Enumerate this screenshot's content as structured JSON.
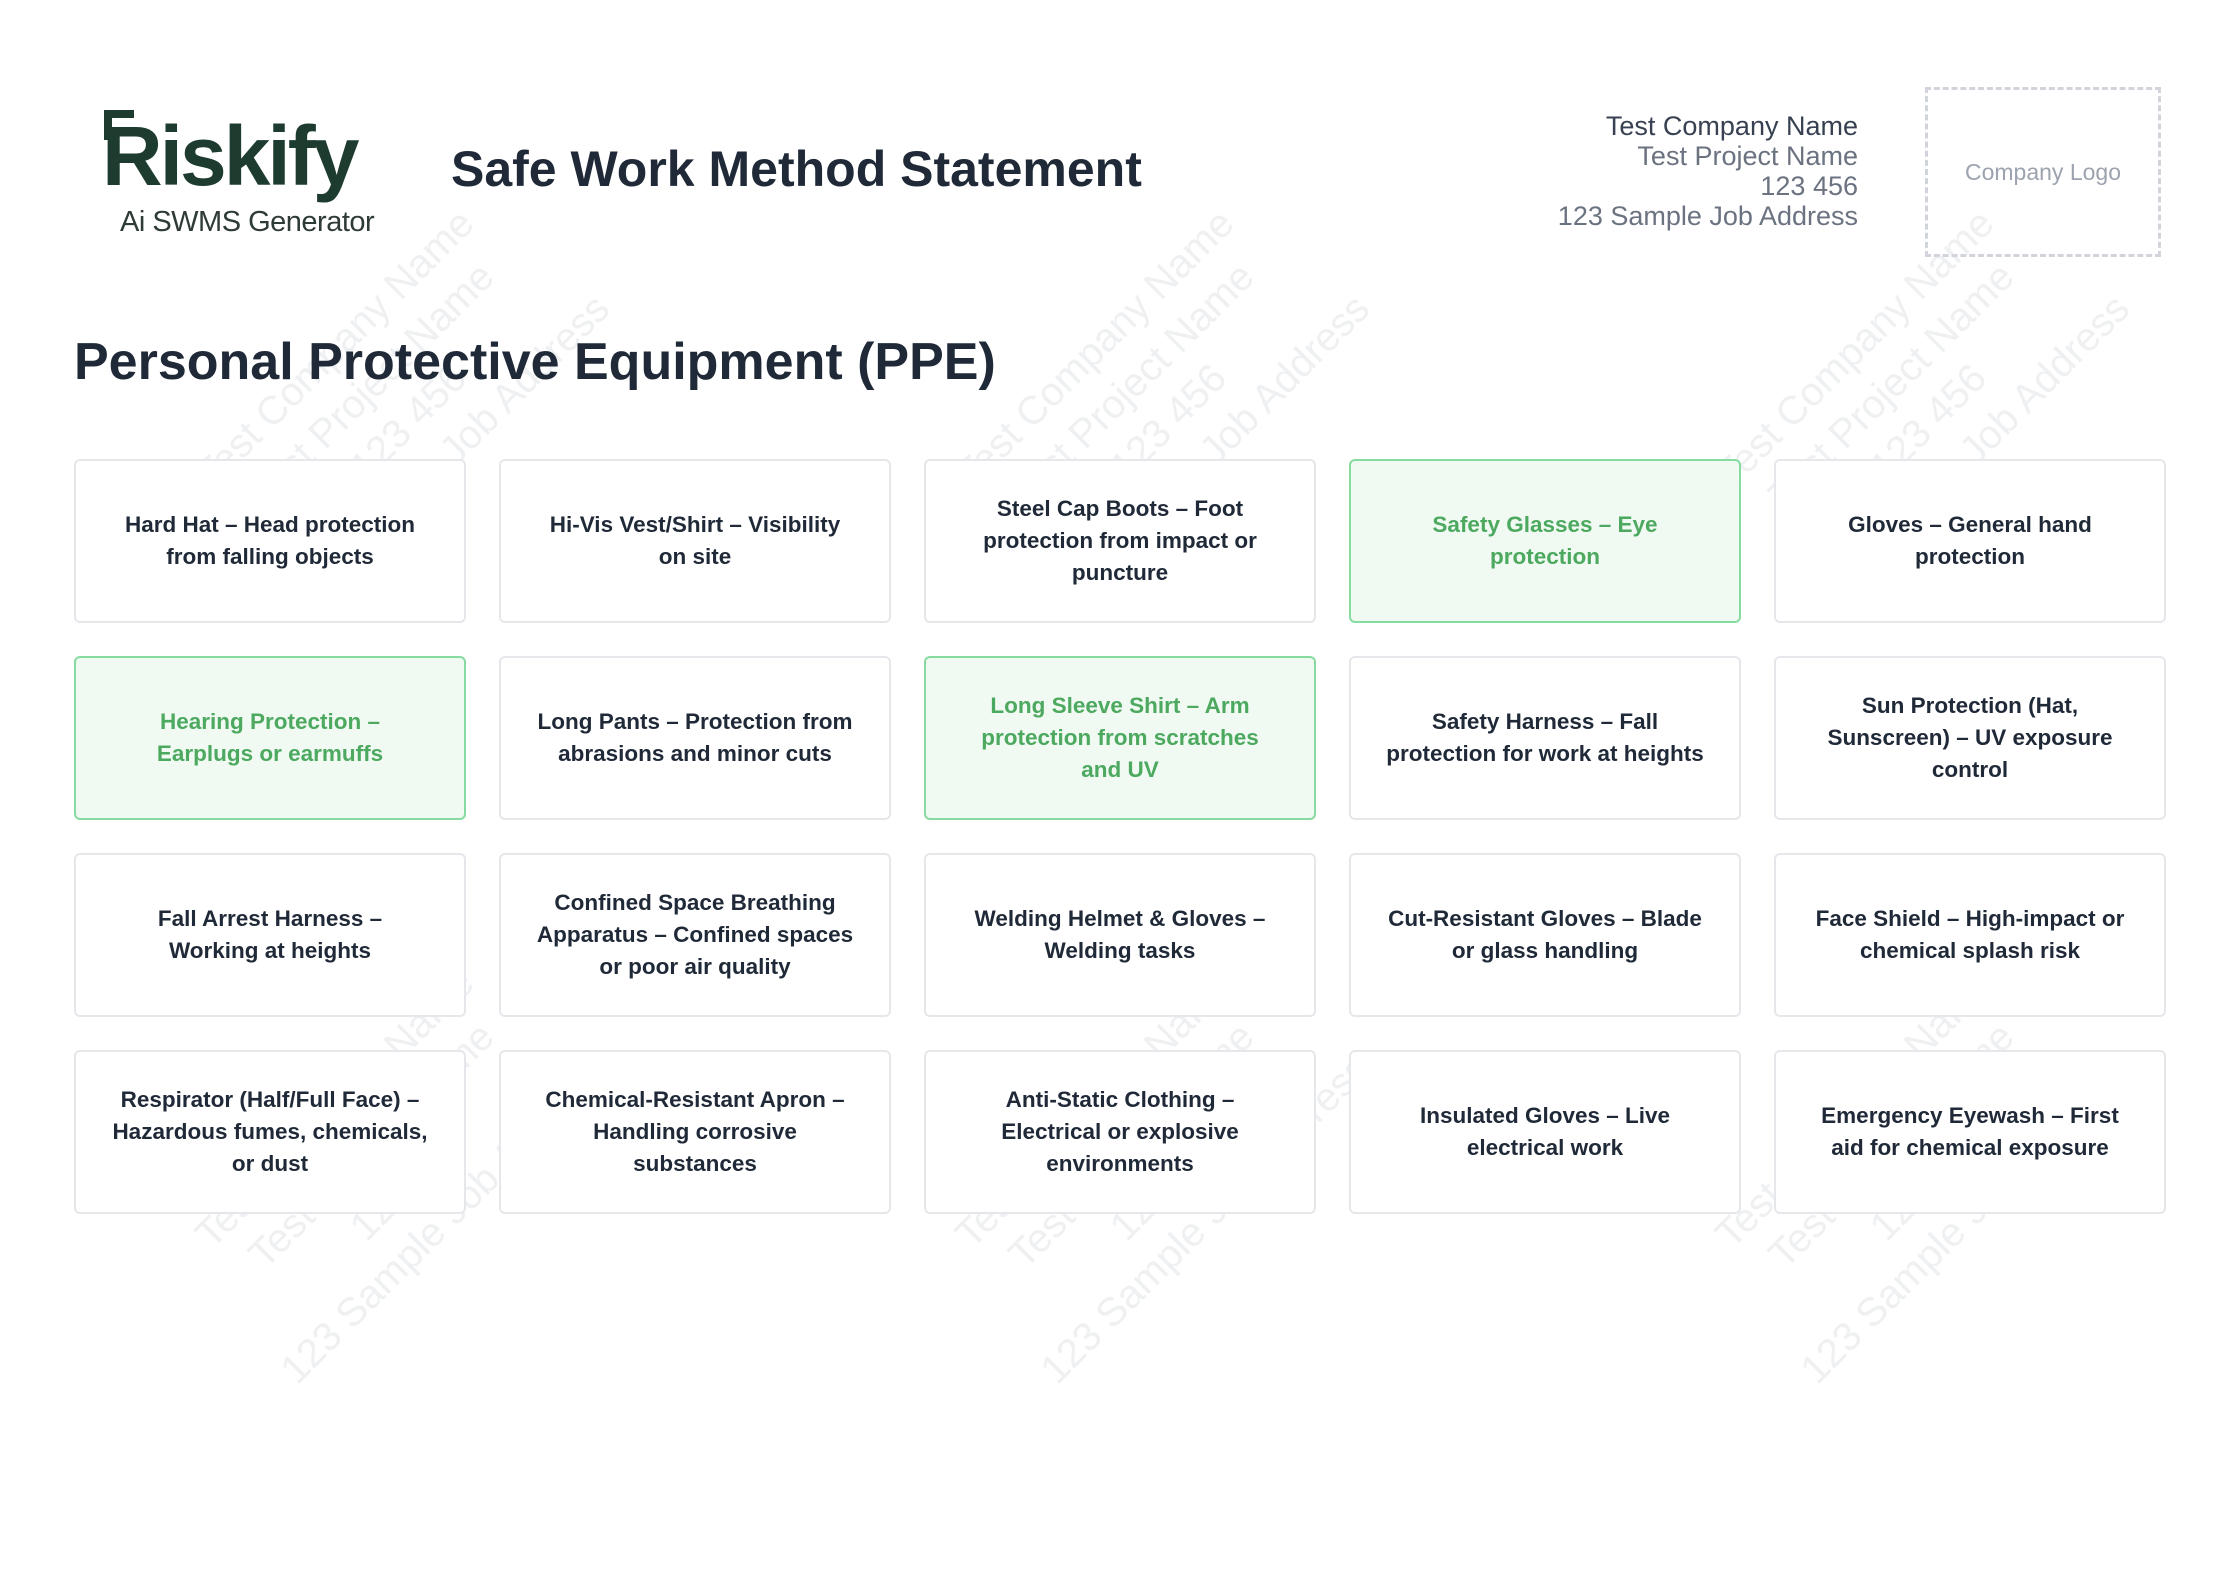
{
  "brand": {
    "logo_main": "Riskify",
    "logo_tagline": "Ai SWMS Generator"
  },
  "document": {
    "title": "Safe Work Method Statement"
  },
  "company": {
    "name": "Test Company Name",
    "project": "Test Project Name",
    "number": "123 456",
    "address": "123 Sample Job Address",
    "logo_placeholder": "Company Logo"
  },
  "watermark": {
    "lines": [
      "Test Company Name",
      "Test Project Name",
      "123 456",
      "123 Sample Job Address"
    ]
  },
  "section": {
    "title": "Personal Protective Equipment (PPE)"
  },
  "ppe_items": [
    {
      "label": "Hard Hat – Head protection from falling objects",
      "selected": false
    },
    {
      "label": "Hi-Vis Vest/Shirt – Visibility on site",
      "selected": false
    },
    {
      "label": "Steel Cap Boots – Foot protection from impact or puncture",
      "selected": false
    },
    {
      "label": "Safety Glasses – Eye protection",
      "selected": true
    },
    {
      "label": "Gloves – General hand protection",
      "selected": false
    },
    {
      "label": "Hearing Protection – Earplugs or earmuffs",
      "selected": true
    },
    {
      "label": "Long Pants – Protection from abrasions and minor cuts",
      "selected": false
    },
    {
      "label": "Long Sleeve Shirt – Arm protection from scratches and UV",
      "selected": true
    },
    {
      "label": "Safety Harness – Fall protection for work at heights",
      "selected": false
    },
    {
      "label": "Sun Protection (Hat, Sunscreen) – UV exposure control",
      "selected": false
    },
    {
      "label": "Fall Arrest Harness – Working at heights",
      "selected": false
    },
    {
      "label": "Confined Space Breathing Apparatus – Confined spaces or poor air quality",
      "selected": false
    },
    {
      "label": "Welding Helmet & Gloves – Welding tasks",
      "selected": false
    },
    {
      "label": "Cut-Resistant Gloves – Blade or glass handling",
      "selected": false
    },
    {
      "label": "Face Shield – High-impact or chemical splash risk",
      "selected": false
    },
    {
      "label": "Respirator (Half/Full Face) – Hazardous fumes, chemicals, or dust",
      "selected": false
    },
    {
      "label": "Chemical-Resistant Apron – Handling corrosive substances",
      "selected": false
    },
    {
      "label": "Anti-Static Clothing – Electrical or explosive environments",
      "selected": false
    },
    {
      "label": "Insulated Gloves – Live electrical work",
      "selected": false
    },
    {
      "label": "Emergency Eyewash – First aid for chemical exposure",
      "selected": false
    }
  ],
  "colors": {
    "selected_bg": "#f0faf2",
    "selected_border": "#86dca0",
    "selected_text": "#4ca95f",
    "brand": "#1d3b2e"
  }
}
